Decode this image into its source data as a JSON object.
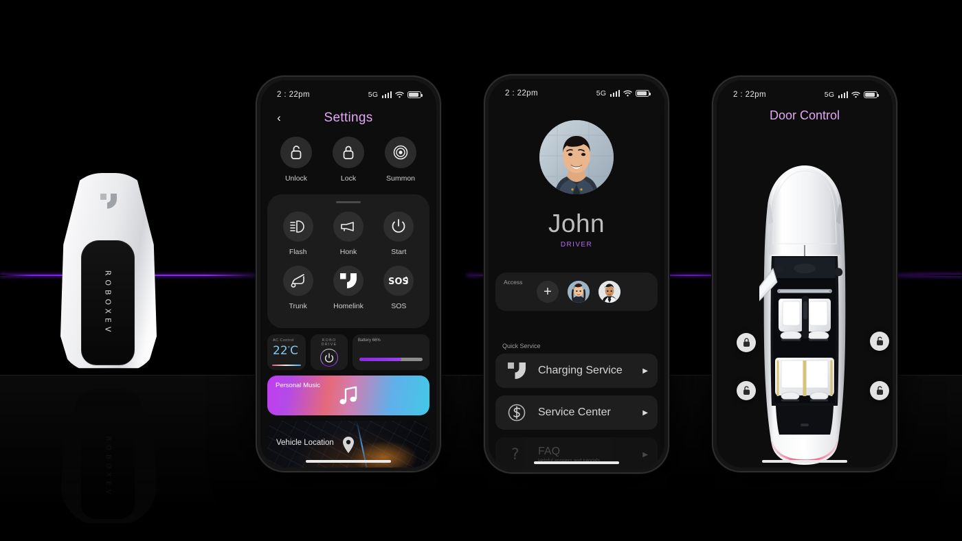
{
  "scene": {
    "background_color": "#000000",
    "accent_purple": "#8a2be2",
    "key_fob": {
      "brand_text": "ROBOXEV",
      "logo_icon": "roboxev-logo-icon"
    }
  },
  "status_bar": {
    "time": "2 : 22pm",
    "network": "5G",
    "signal_icon": "cellular-signal-icon",
    "wifi_icon": "wifi-icon",
    "battery_icon": "battery-icon"
  },
  "phone1": {
    "title": "Settings",
    "back_icon": "back-chevron-icon",
    "quick_actions": [
      {
        "label": "Unlock",
        "icon": "unlock-icon"
      },
      {
        "label": "Lock",
        "icon": "lock-icon"
      },
      {
        "label": "Summon",
        "icon": "summon-icon"
      }
    ],
    "grid_actions": [
      {
        "label": "Flash",
        "icon": "headlight-flash-icon"
      },
      {
        "label": "Honk",
        "icon": "horn-icon"
      },
      {
        "label": "Start",
        "icon": "power-icon"
      },
      {
        "label": "Trunk",
        "icon": "trunk-open-icon"
      },
      {
        "label": "Homelink",
        "icon": "homelink-logo-icon"
      },
      {
        "label": "SOS",
        "icon": "sos-icon"
      }
    ],
    "ac_control": {
      "caption": "AC Control",
      "temperature": "22",
      "unit": "C",
      "degree": "°"
    },
    "robo_drive": {
      "caption": "ROBO DRIVE",
      "icon": "power-icon"
    },
    "battery": {
      "label": "Battery 66%",
      "percent": 66
    },
    "music_card": {
      "title": "Personal Music",
      "icon": "music-note-icon"
    },
    "location_card": {
      "title": "Vehicle Location",
      "icon": "map-pin-icon"
    }
  },
  "phone2": {
    "user_name": "John",
    "user_role": "DRIVER",
    "avatar_icon": "user-avatar",
    "access": {
      "caption": "Access",
      "add_icon": "plus-icon",
      "members": [
        "member-avatar-1",
        "member-avatar-2"
      ]
    },
    "quick_service": {
      "caption": "Quick Service",
      "items": [
        {
          "title": "Charging Service",
          "subtitle": "",
          "icon": "roboxev-logo-icon",
          "arrow": "▶",
          "disabled": false
        },
        {
          "title": "Service Center",
          "subtitle": "",
          "icon": "service-center-icon",
          "arrow": "▶",
          "disabled": false
        },
        {
          "title": "FAQ",
          "subtitle": "Helpful answers and tutorials",
          "icon": "question-mark-icon",
          "arrow": "▶",
          "disabled": true
        }
      ]
    }
  },
  "phone3": {
    "title": "Door Control",
    "car_icon": "car-top-view",
    "door_locks": [
      {
        "position": "front-left",
        "state": "locked",
        "icon": "lock-icon"
      },
      {
        "position": "front-right",
        "state": "unlocked",
        "icon": "unlock-icon"
      },
      {
        "position": "rear-left",
        "state": "unlocked",
        "icon": "unlock-icon"
      },
      {
        "position": "rear-right",
        "state": "unlocked",
        "icon": "unlock-icon"
      }
    ]
  }
}
